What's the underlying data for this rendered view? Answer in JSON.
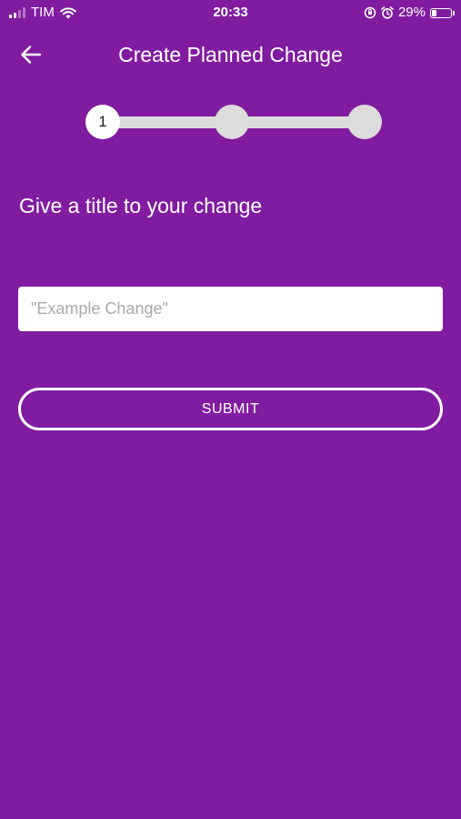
{
  "status_bar": {
    "carrier": "TIM",
    "time": "20:33",
    "battery_percent": "29%",
    "battery_level": 0.29,
    "icons": [
      "signal-icon",
      "wifi-icon",
      "orientation-lock-icon",
      "alarm-icon",
      "battery-icon"
    ]
  },
  "header": {
    "title": "Create Planned Change",
    "back_icon": "arrow-left-icon"
  },
  "stepper": {
    "steps": [
      {
        "label": "1",
        "active": true
      },
      {
        "label": "",
        "active": false
      },
      {
        "label": "",
        "active": false
      }
    ]
  },
  "form": {
    "prompt": "Give a title to your change",
    "title_placeholder": "\"Example Change\"",
    "title_value": "",
    "submit_label": "SUBMIT"
  },
  "colors": {
    "background": "#811ca1",
    "step_inactive": "#dcdcdc",
    "text": "#ffffff"
  }
}
